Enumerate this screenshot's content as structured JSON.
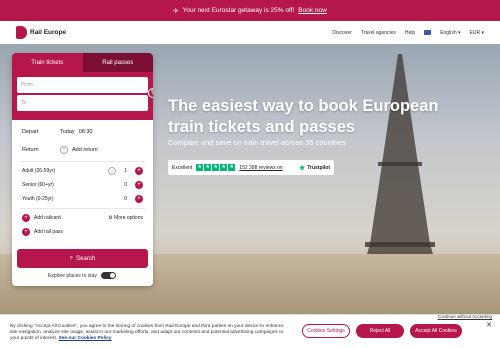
{
  "promo": {
    "text": "Your next Eurostar getaway is 25% off!",
    "link": "Book now"
  },
  "nav": {
    "logo": "Rail Europe",
    "links": [
      "Discover",
      "Travel agencies",
      "Help"
    ],
    "language": "English",
    "currency": "EUR"
  },
  "hero": {
    "title": "The easiest way to book European train tickets and passes",
    "subtitle": "Compare and save on train travel across 35 countries",
    "trust": {
      "rating_word": "Excellent",
      "reviews": "152 398 reviews on",
      "brand": "Trustpilot",
      "stars": 5
    }
  },
  "panel": {
    "tabs": [
      "Train tickets",
      "Rail passes"
    ],
    "from_placeholder": "From",
    "to_placeholder": "To",
    "depart_label": "Depart",
    "depart_day": "Today",
    "depart_time": "08:30",
    "return_label": "Return",
    "add_return": "Add return",
    "passengers": [
      {
        "label": "Adult (26-59yr)",
        "count": "1"
      },
      {
        "label": "Senior (60+yr)",
        "count": "0"
      },
      {
        "label": "Youth (0-25yr)",
        "count": "0"
      }
    ],
    "add_railcard": "Add railcard",
    "more_options": "More options",
    "add_rail_pass": "Add rail pass",
    "search": "Search",
    "explore": "Explore places to stay"
  },
  "cookie": {
    "text": "By clicking \"Accept All Cookies\", you agree to the storing of cookies from Rail Europe and third parties on your device to enhance site navigation, analyze site usage, assist in our marketing efforts, and adapt our contents and potential advertising campaigns to your points of interest.",
    "policy_link": "See our Cookies Policy",
    "continue_without": "Continue without Accepting",
    "settings": "Cookies Settings",
    "reject": "Reject All",
    "accept": "Accept All Cookies"
  },
  "colors": {
    "brand": "#b5174a",
    "trustpilot": "#00b67a"
  }
}
